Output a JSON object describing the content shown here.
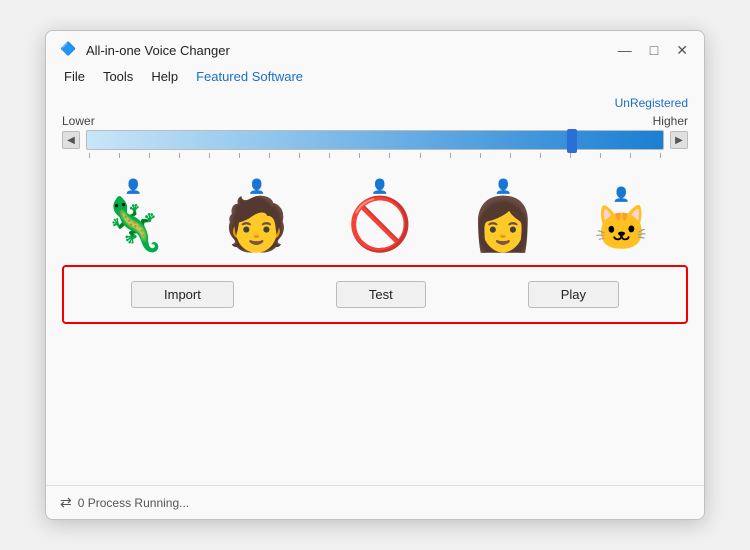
{
  "window": {
    "title": "All-in-one Voice Changer",
    "icon": "🔷"
  },
  "window_controls": {
    "minimize": "—",
    "maximize": "□",
    "close": "✕"
  },
  "menu": {
    "items": [
      "File",
      "Tools",
      "Help",
      "Featured Software"
    ]
  },
  "unregistered": {
    "label": "UnRegistered"
  },
  "pitch": {
    "lower_label": "Lower",
    "higher_label": "Higher"
  },
  "avatars": [
    {
      "id": "dragon",
      "emoji": "🦕",
      "label": "dragon"
    },
    {
      "id": "man",
      "emoji": "🧑",
      "label": "man"
    },
    {
      "id": "no",
      "emoji": "🚫",
      "label": "none"
    },
    {
      "id": "woman",
      "emoji": "👩",
      "label": "woman"
    },
    {
      "id": "cat",
      "emoji": "🐱",
      "label": "cat"
    }
  ],
  "buttons": {
    "import": "Import",
    "test": "Test",
    "play": "Play"
  },
  "status": {
    "icon": "⇄",
    "text": "0 Process Running..."
  }
}
